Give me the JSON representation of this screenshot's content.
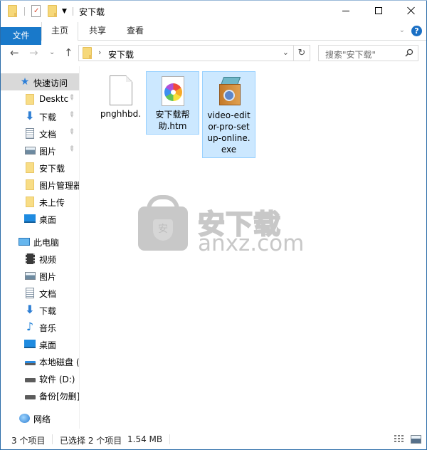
{
  "window": {
    "title": "安下载",
    "controls": {
      "minimize": "minimize",
      "maximize": "maximize",
      "close": "close"
    }
  },
  "quick_access_toolbar": {
    "icons": [
      "folder-icon",
      "properties-icon",
      "new-folder-icon",
      "customize-dropdown-icon"
    ]
  },
  "ribbon": {
    "tabs": [
      {
        "label": "文件",
        "type": "file"
      },
      {
        "label": "主页",
        "active": true
      },
      {
        "label": "共享"
      },
      {
        "label": "查看"
      }
    ],
    "expand_icon": "⌄",
    "help_label": "?"
  },
  "navigation": {
    "back": "←",
    "forward": "→",
    "recent": "⌄",
    "up": "↑",
    "address": {
      "separator": "›",
      "path": "安下载",
      "dropdown": "⌄"
    },
    "refresh": "↻",
    "search": {
      "placeholder": "搜索\"安下载\"",
      "icon": "search-icon"
    }
  },
  "sidebar": {
    "quick_access": {
      "label": "快速访问",
      "icon": "star-icon"
    },
    "quick_items": [
      {
        "label": "Desktc",
        "icon": "folder-icon",
        "pinned": true
      },
      {
        "label": "下载",
        "icon": "download-icon",
        "pinned": true
      },
      {
        "label": "文档",
        "icon": "document-icon",
        "pinned": true
      },
      {
        "label": "图片",
        "icon": "picture-icon",
        "pinned": true
      },
      {
        "label": "安下载",
        "icon": "folder-icon",
        "pinned": false
      },
      {
        "label": "图片管理器",
        "icon": "folder-icon",
        "pinned": false
      },
      {
        "label": "未上传",
        "icon": "folder-icon",
        "pinned": false
      },
      {
        "label": "桌面",
        "icon": "desktop-icon",
        "pinned": false
      }
    ],
    "this_pc": {
      "label": "此电脑",
      "icon": "computer-icon"
    },
    "pc_items": [
      {
        "label": "视频",
        "icon": "video-icon"
      },
      {
        "label": "图片",
        "icon": "picture-icon"
      },
      {
        "label": "文档",
        "icon": "document-icon"
      },
      {
        "label": "下载",
        "icon": "download-icon"
      },
      {
        "label": "音乐",
        "icon": "music-icon"
      },
      {
        "label": "桌面",
        "icon": "desktop-icon"
      },
      {
        "label": "本地磁盘 (",
        "icon": "system-drive-icon"
      },
      {
        "label": "软件 (D:)",
        "icon": "drive-icon"
      },
      {
        "label": "备份[勿删]",
        "icon": "drive-icon"
      }
    ],
    "network": {
      "label": "网络",
      "icon": "network-icon"
    },
    "pin_glyph": "📌"
  },
  "files": [
    {
      "name": "pnghhbd.",
      "icon": "blank-file-icon",
      "selected": false
    },
    {
      "name": "安下载帮助.htm",
      "icon": "htm-file-icon",
      "selected": true
    },
    {
      "name": "video-editor-pro-setup-online.exe",
      "icon": "installer-icon",
      "selected": true
    }
  ],
  "watermark": {
    "text_cn": "安下载",
    "text_url": "anxz.com",
    "badge": "安"
  },
  "status_bar": {
    "item_count": "3 个项目",
    "selection": "已选择 2 个项目",
    "size": "1.54 MB",
    "views": [
      "details-view",
      "large-icons-view"
    ]
  },
  "colors": {
    "accent": "#1979ca",
    "selection_bg": "#cce8ff",
    "selection_border": "#99d1ff",
    "sidebar_selected": "#d9d9d9",
    "window_border": "#2b6ca8"
  }
}
